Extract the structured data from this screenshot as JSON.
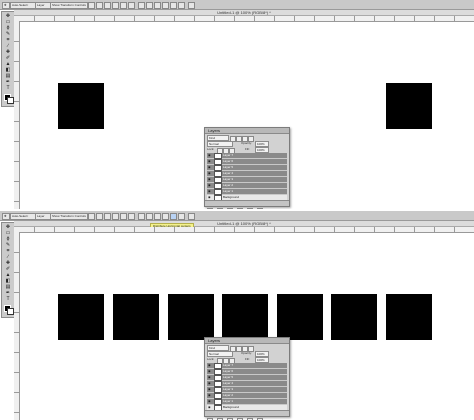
{
  "options_bar": {
    "auto_select_label": "Auto-Select:",
    "auto_select_value": "Layer",
    "transform_label": "Show Transform Controls"
  },
  "document_title": "Untitled-1 @ 100% (RGB/8*) *",
  "tooltip": "Distribute Horizontal centers",
  "layers_panel": {
    "title": "Layers",
    "kind_label": "Kind",
    "blend_mode": "Normal",
    "opacity_label": "Opacity:",
    "opacity_value": "100%",
    "lock_label": "Lock:",
    "fill_label": "Fill:",
    "fill_value": "100%",
    "layers": [
      "Layer 7",
      "Layer 6",
      "Layer 5",
      "Layer 4",
      "Layer 3",
      "Layer 2",
      "Layer 1",
      "Background"
    ]
  },
  "colors": {
    "canvas": "#ffffff",
    "shape": "#000000",
    "selected_layer": "#8a8a8a",
    "panel": "#d2d2d2"
  },
  "icons": [
    "move-icon",
    "marquee-icon",
    "lasso-icon",
    "quick-select-icon",
    "crop-icon",
    "eyedropper-icon",
    "healing-icon",
    "brush-icon",
    "stamp-icon",
    "history-brush-icon",
    "eraser-icon",
    "gradient-icon",
    "blur-icon",
    "dodge-icon",
    "pen-icon",
    "type-icon",
    "path-select-icon",
    "shape-icon",
    "hand-icon",
    "zoom-icon",
    "eye-icon"
  ]
}
